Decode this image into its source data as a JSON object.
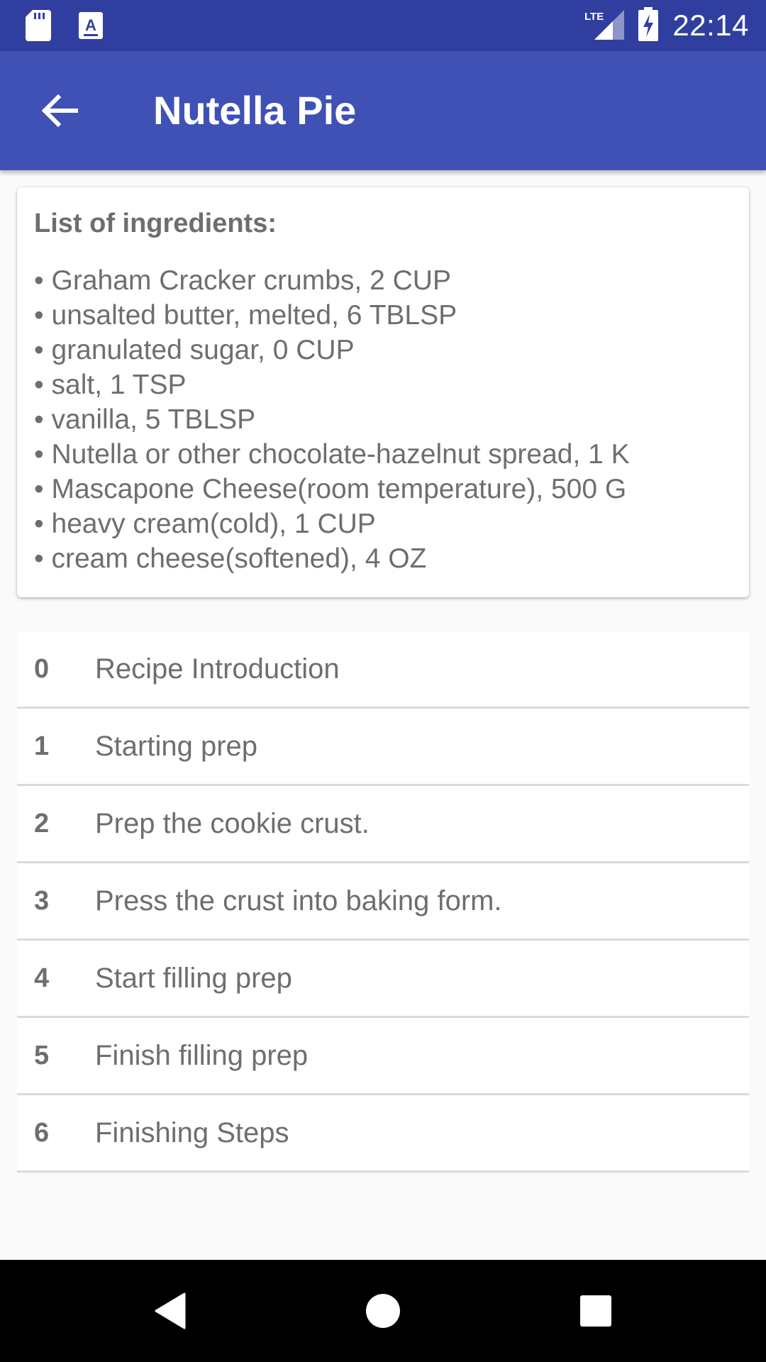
{
  "status_bar": {
    "time": "22:14",
    "network_label": "LTE",
    "icons": [
      "sd-card-icon",
      "keyboard-a-icon",
      "lte-signal-icon",
      "battery-charging-icon"
    ]
  },
  "app_bar": {
    "title": "Nutella Pie",
    "back_icon": "arrow-back-icon",
    "color": "#3f51b5",
    "status_color": "#303f9f"
  },
  "ingredients": {
    "title": "List of ingredients:",
    "items": [
      "Graham Cracker crumbs, 2 CUP",
      "unsalted butter, melted, 6 TBLSP",
      "granulated sugar, 0 CUP",
      "salt, 1 TSP",
      "vanilla, 5 TBLSP",
      "Nutella or other chocolate-hazelnut spread, 1 K",
      "Mascapone Cheese(room temperature), 500 G",
      "heavy cream(cold), 1 CUP",
      "cream cheese(softened), 4 OZ"
    ]
  },
  "steps": [
    {
      "number": "0",
      "label": "Recipe Introduction"
    },
    {
      "number": "1",
      "label": "Starting prep"
    },
    {
      "number": "2",
      "label": "Prep the cookie crust."
    },
    {
      "number": "3",
      "label": "Press the crust into baking form."
    },
    {
      "number": "4",
      "label": "Start filling prep"
    },
    {
      "number": "5",
      "label": "Finish filling prep"
    },
    {
      "number": "6",
      "label": "Finishing Steps"
    }
  ],
  "nav_bar": {
    "icons": [
      "back-triangle-icon",
      "home-circle-icon",
      "recents-square-icon"
    ]
  }
}
